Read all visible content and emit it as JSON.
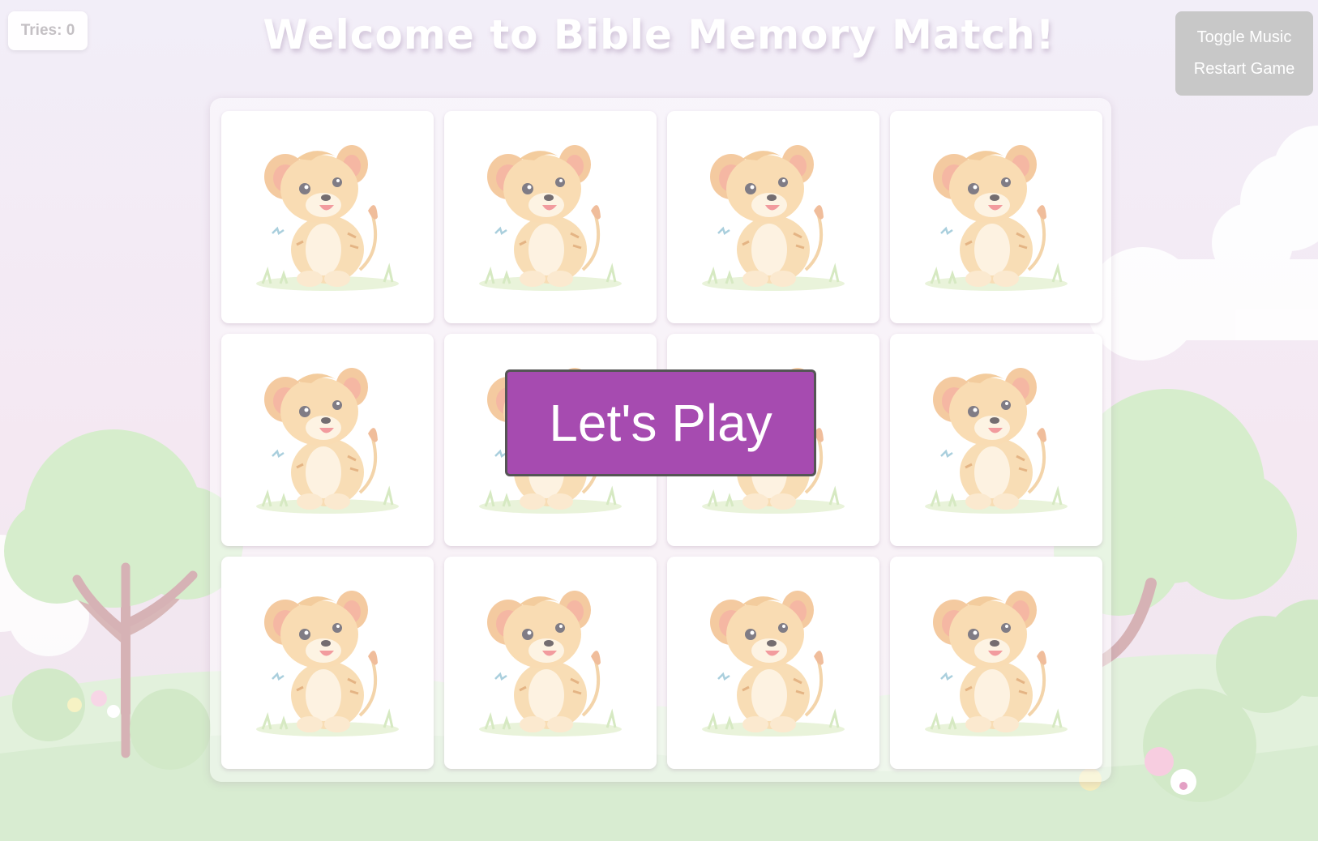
{
  "hud": {
    "tries_label": "Tries: 0"
  },
  "header": {
    "title": "Welcome to Bible Memory Match!"
  },
  "controls": {
    "toggle_music": "Toggle Music",
    "restart_game": "Restart Game"
  },
  "overlay": {
    "play_label": "Let's Play"
  },
  "board": {
    "rows": 3,
    "cols": 4,
    "card_back_icon": "lion-cub-icon",
    "cards": [
      {
        "state": "face-down"
      },
      {
        "state": "face-down"
      },
      {
        "state": "face-down"
      },
      {
        "state": "face-down"
      },
      {
        "state": "face-down"
      },
      {
        "state": "face-down"
      },
      {
        "state": "face-down"
      },
      {
        "state": "face-down"
      },
      {
        "state": "face-down"
      },
      {
        "state": "face-down"
      },
      {
        "state": "face-down"
      },
      {
        "state": "face-down"
      }
    ]
  },
  "colors": {
    "play_button": "#a64bb0",
    "controls_bg": "#c8c8c8",
    "background": "#f3eef8",
    "hill_green": "#dcefd4"
  }
}
